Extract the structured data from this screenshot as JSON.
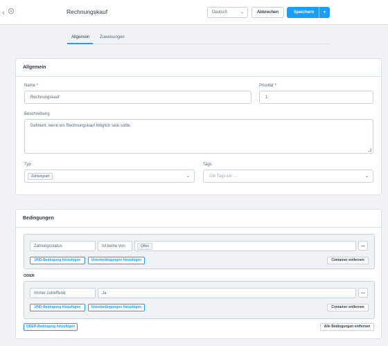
{
  "header": {
    "title": "Rechnungskauf",
    "language": "Deutsch",
    "cancel_label": "Abbrechen",
    "save_label": "Speichern"
  },
  "tabs": [
    "Allgemein",
    "Zuweisungen"
  ],
  "general": {
    "heading": "Allgemein",
    "name_label": "Name",
    "name_value": "Rechnungskauf",
    "priority_label": "Priorität",
    "priority_value": "1",
    "required_mark": "*",
    "description_label": "Beschreibung",
    "description_value": "Definiert, wenn ein Rechnungskauf Möglich sein sollte.",
    "type_label": "Typ",
    "type_chip": "Zahlungsart",
    "tags_label": "Tags",
    "tags_placeholder": "Gib Tags ein ..."
  },
  "conditions": {
    "heading": "Bedingungen",
    "groups": [
      {
        "field": "Zahlungsstatus",
        "operator": "Ist keine von",
        "value_chip": "Offen",
        "and_button": "UND-Bedingung hinzufügen",
        "sub_button": "Unterbedingungen hinzufügen",
        "remove_button": "Container entfernen",
        "more": "..."
      },
      {
        "field": "Immer zutreffend",
        "operator": "Ja",
        "and_button": "UND-Bedingung hinzufügen",
        "sub_button": "Unterbedingungen hinzufügen",
        "remove_button": "Container entfernen",
        "more": "..."
      }
    ],
    "or_label": "ODER",
    "add_or_button": "ODER-Bedingung hinzufügen",
    "remove_all_button": "Alle Bedingungen entfernen"
  },
  "colors": {
    "accent": "#189eff",
    "required": "#de294c"
  }
}
